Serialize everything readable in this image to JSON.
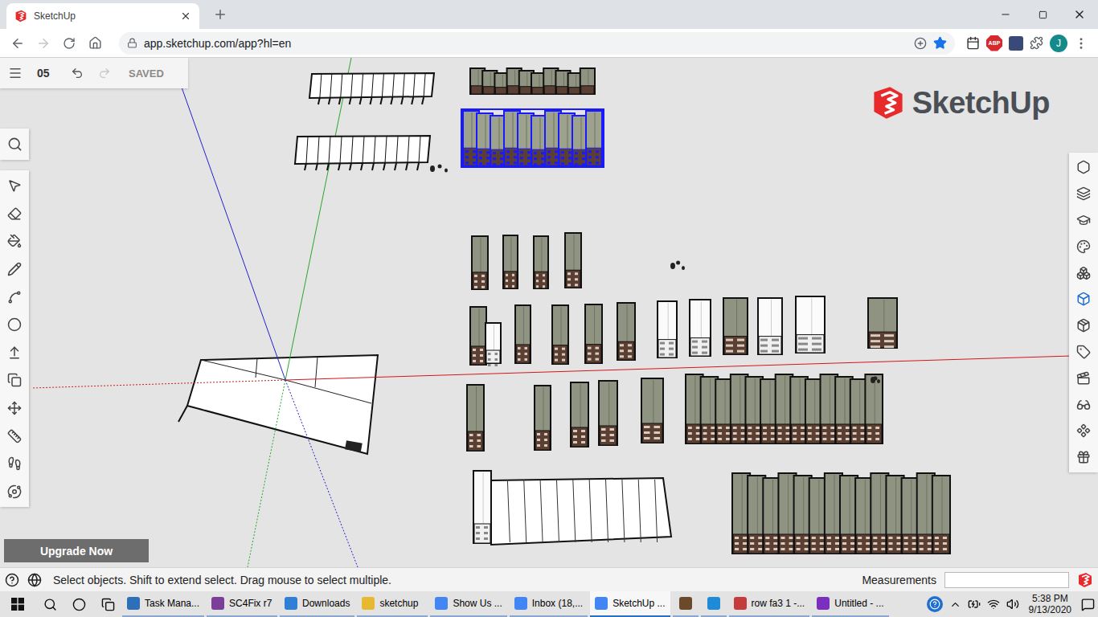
{
  "browser": {
    "tab": {
      "title": "SketchUp",
      "selected": true
    },
    "url": "app.sketchup.com/app?hl=en",
    "forward_disabled": true,
    "bookmarked": true,
    "extension_badge": "ABP",
    "avatar": "J"
  },
  "app": {
    "file_name": "05",
    "save_status": "SAVED",
    "redo_disabled": true,
    "logo": "SketchUp",
    "right_panels": [
      {
        "selected": false
      },
      {
        "selected": false
      },
      {
        "selected": false
      },
      {
        "selected": false
      },
      {
        "selected": false
      },
      {
        "selected": true
      },
      {
        "selected": false
      },
      {
        "selected": false
      },
      {
        "selected": false
      },
      {
        "selected": false
      },
      {
        "selected": false
      },
      {
        "selected": false
      }
    ],
    "upgrade_button": "Upgrade Now",
    "status_bar": {
      "message": "Select objects. Shift to extend select. Drag mouse to select multiple.",
      "measurements_label": "Measurements",
      "measurements_value": ""
    },
    "scene": {
      "groups": [
        {
          "kind": "frame",
          "selected": false
        },
        {
          "kind": "frame",
          "selected": false
        },
        {
          "kind": "row",
          "selected": false
        },
        {
          "kind": "row",
          "selected": true
        },
        {
          "kind": "blob",
          "selected": false
        },
        {
          "kind": "tower",
          "selected": false
        },
        {
          "kind": "tower",
          "selected": false
        },
        {
          "kind": "tower",
          "selected": false
        },
        {
          "kind": "tower",
          "selected": false
        },
        {
          "kind": "tower",
          "selected": false
        },
        {
          "kind": "white-tower",
          "selected": false
        },
        {
          "kind": "tower",
          "selected": false
        },
        {
          "kind": "tower",
          "selected": false
        },
        {
          "kind": "tower",
          "selected": false
        },
        {
          "kind": "tower",
          "selected": false
        },
        {
          "kind": "white-tower",
          "selected": false
        },
        {
          "kind": "white-tower",
          "selected": false
        },
        {
          "kind": "tower",
          "selected": false
        },
        {
          "kind": "white-tower",
          "selected": false
        },
        {
          "kind": "white-tower",
          "selected": false
        },
        {
          "kind": "tower",
          "selected": false
        },
        {
          "kind": "blob",
          "selected": false
        },
        {
          "kind": "tower",
          "selected": false
        },
        {
          "kind": "tower",
          "selected": false
        },
        {
          "kind": "tower",
          "selected": false
        },
        {
          "kind": "tower",
          "selected": false
        },
        {
          "kind": "tower",
          "selected": false
        },
        {
          "kind": "row",
          "selected": false
        },
        {
          "kind": "blob",
          "selected": false
        },
        {
          "kind": "white-tower",
          "selected": false
        },
        {
          "kind": "slab",
          "selected": false
        },
        {
          "kind": "row",
          "selected": false
        },
        {
          "kind": "ground",
          "selected": false
        }
      ]
    }
  },
  "taskbar": {
    "items": [
      {
        "kind": "button",
        "label": "Task Mana...",
        "selected": false
      },
      {
        "kind": "button",
        "label": "SC4Fix r7",
        "selected": false
      },
      {
        "kind": "button",
        "label": "Downloads",
        "selected": false
      },
      {
        "kind": "button",
        "label": "sketchup",
        "selected": false
      },
      {
        "kind": "button",
        "label": "Show Us ...",
        "selected": false
      },
      {
        "kind": "button",
        "label": "Inbox (18,...",
        "selected": false
      },
      {
        "kind": "button",
        "label": "SketchUp ...",
        "selected": true
      },
      {
        "kind": "icon",
        "selected": false
      },
      {
        "kind": "icon",
        "selected": false
      },
      {
        "kind": "button",
        "label": "row fa3 1 -...",
        "selected": false
      },
      {
        "kind": "button",
        "label": "Untitled - ...",
        "selected": false
      }
    ],
    "clock": {
      "time": "5:38 PM",
      "date": "9/13/2020"
    }
  }
}
